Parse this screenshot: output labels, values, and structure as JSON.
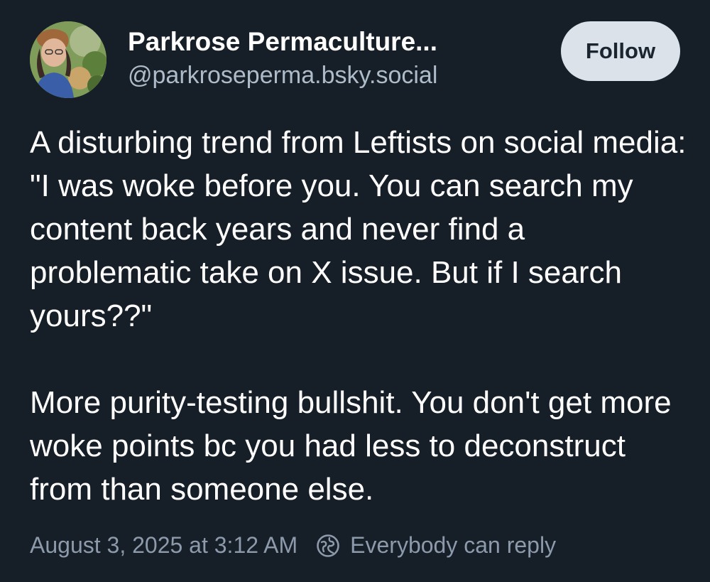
{
  "post": {
    "author": {
      "display_name": "Parkrose Permaculture...",
      "handle": "@parkroseperma.bsky.social",
      "avatar_icon": "avatar-photo"
    },
    "follow_label": "Follow",
    "text_paragraphs": [
      "A disturbing trend from Leftists on social media: \"I was woke before you. You can search my content back years and never find a problematic take on X issue. But if I search yours??\"",
      "More purity-testing bullshit. You don't get more woke points bc you had less to deconstruct from than someone else."
    ],
    "timestamp": "August 3, 2025 at 3:12 AM",
    "reply_setting": "Everybody can reply",
    "reply_icon": "globe-reply-icon"
  },
  "colors": {
    "background": "#161e27",
    "text_primary": "#ffffff",
    "text_secondary": "#aebbc9",
    "text_muted": "#8c9aab",
    "follow_bg": "#dce2ea",
    "follow_text": "#1b2530"
  }
}
